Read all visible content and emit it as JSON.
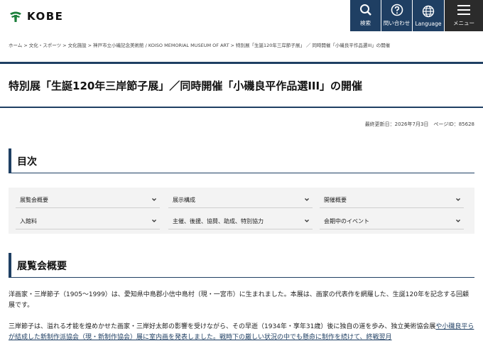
{
  "header": {
    "logo_text": "KOBE",
    "nav": [
      {
        "label": "検索",
        "icon": "search-icon"
      },
      {
        "label": "問い合わせ",
        "icon": "question-icon"
      },
      {
        "label": "Language",
        "icon": "globe-icon"
      },
      {
        "label": "メニュー",
        "icon": "hamburger-icon"
      }
    ]
  },
  "breadcrumb": [
    "ホーム",
    "文化・スポーツ",
    "文化施設",
    "神戸市立小磯記念美術館 / KOISO MEMORIAL MUSEUM OF ART",
    "特別展「生誕120年三岸節子展」",
    "同時開催「小磯良平作品選III」の開催"
  ],
  "page_title": "特別展「生誕120年三岸節子展」／同時開催「小磯良平作品選III」の開催",
  "updated": "最終更新日：2026年7月3日　ページID：85628",
  "toc": {
    "heading": "目次",
    "items": [
      "展覧会概要",
      "展示構成",
      "開催概要",
      "入館料",
      "主催、後援、協賛、助成、特別協力",
      "会期中のイベント"
    ]
  },
  "section1": {
    "heading": "展覧会概要",
    "para1": "洋画家・三岸節子（1905〜1999）は、愛知県中島郡小信中島村（現・一宮市）に生まれました。本展は、画家の代表作を網羅した、生誕120年を記念する回顧展です。",
    "para2_a": "三岸節子は、溢れる才能を煌めかせた画家・三岸好太郎の影響を受けながら、その早逝（1934年・享年31歳）後に独自の道を歩み、独立美術協会展",
    "para2_link": "や小磯良平らが結成した新制作派協会（現・新制作協会）展に室内画を発表しました。戦時下の厳しい状況の中でも懸命に制作を続けて、終戦翌月"
  },
  "colors": {
    "navy": "#1f3f63",
    "menu": "#2b2b2b",
    "green": "#1b7f3b"
  }
}
